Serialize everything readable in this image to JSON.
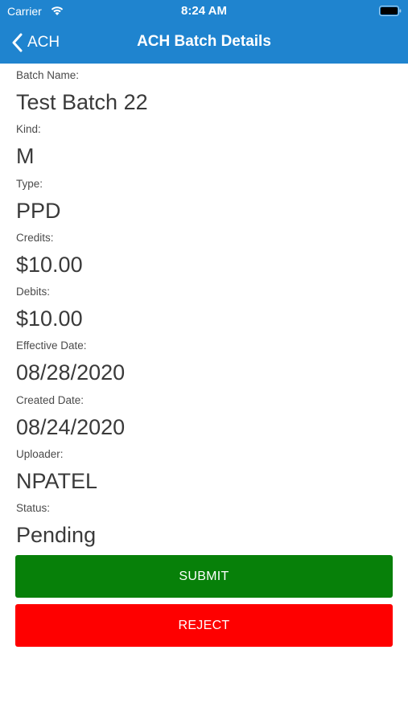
{
  "status_bar": {
    "carrier": "Carrier",
    "time": "8:24 AM",
    "wifi_icon": "wifi-icon",
    "battery_icon": "battery-icon"
  },
  "nav": {
    "back_label": "ACH",
    "back_icon": "chevron-left-icon",
    "title": "ACH Batch Details"
  },
  "fields": [
    {
      "label": "Batch Name:",
      "value": "Test Batch 22"
    },
    {
      "label": "Kind:",
      "value": "M"
    },
    {
      "label": "Type:",
      "value": "PPD"
    },
    {
      "label": "Credits:",
      "value": "$10.00"
    },
    {
      "label": "Debits:",
      "value": "$10.00"
    },
    {
      "label": "Effective Date:",
      "value": "08/28/2020"
    },
    {
      "label": "Created Date:",
      "value": "08/24/2020"
    },
    {
      "label": "Uploader:",
      "value": "NPATEL"
    },
    {
      "label": "Status:",
      "value": "Pending"
    }
  ],
  "actions": {
    "submit_label": "SUBMIT",
    "reject_label": "REJECT"
  },
  "colors": {
    "header": "#1f84cf",
    "submit": "#078009",
    "reject": "#fe0000"
  }
}
